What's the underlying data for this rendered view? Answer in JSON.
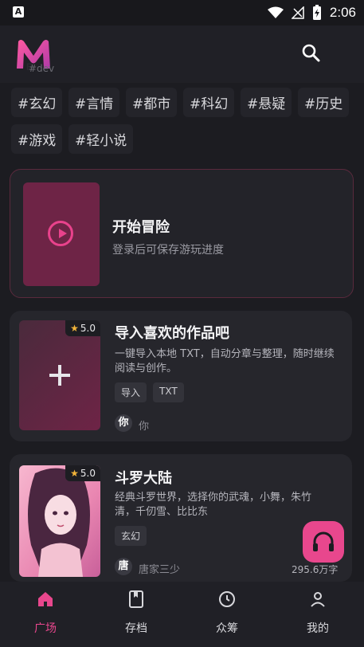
{
  "status": {
    "left_icon": "A",
    "time": "2:06"
  },
  "app": {
    "logo_text": "#dev"
  },
  "tags": [
    "#玄幻",
    "#言情",
    "#都市",
    "#科幻",
    "#悬疑",
    "#历史",
    "#游戏",
    "#轻小说"
  ],
  "adventure": {
    "title": "开始冒险",
    "subtitle": "登录后可保存游玩进度"
  },
  "cards": [
    {
      "rating": "5.0",
      "title": "导入喜欢的作品吧",
      "desc": "一键导入本地 TXT，自动分章与整理，随时继续阅读与创作。",
      "chips": [
        "导入",
        "TXT"
      ],
      "author_initial": "你",
      "author": "你"
    },
    {
      "rating": "5.0",
      "title": "斗罗大陆",
      "desc": "经典斗罗世界，选择你的武魂，小舞，朱竹清，千仞雪、比比东",
      "chips": [
        "玄幻"
      ],
      "author_initial": "唐",
      "author": "唐家三少",
      "word_count": "295.6万字"
    }
  ],
  "nav": [
    "广场",
    "存档",
    "众筹",
    "我的"
  ],
  "colors": {
    "accent": "#e8478d",
    "background": "#1c1c21"
  }
}
